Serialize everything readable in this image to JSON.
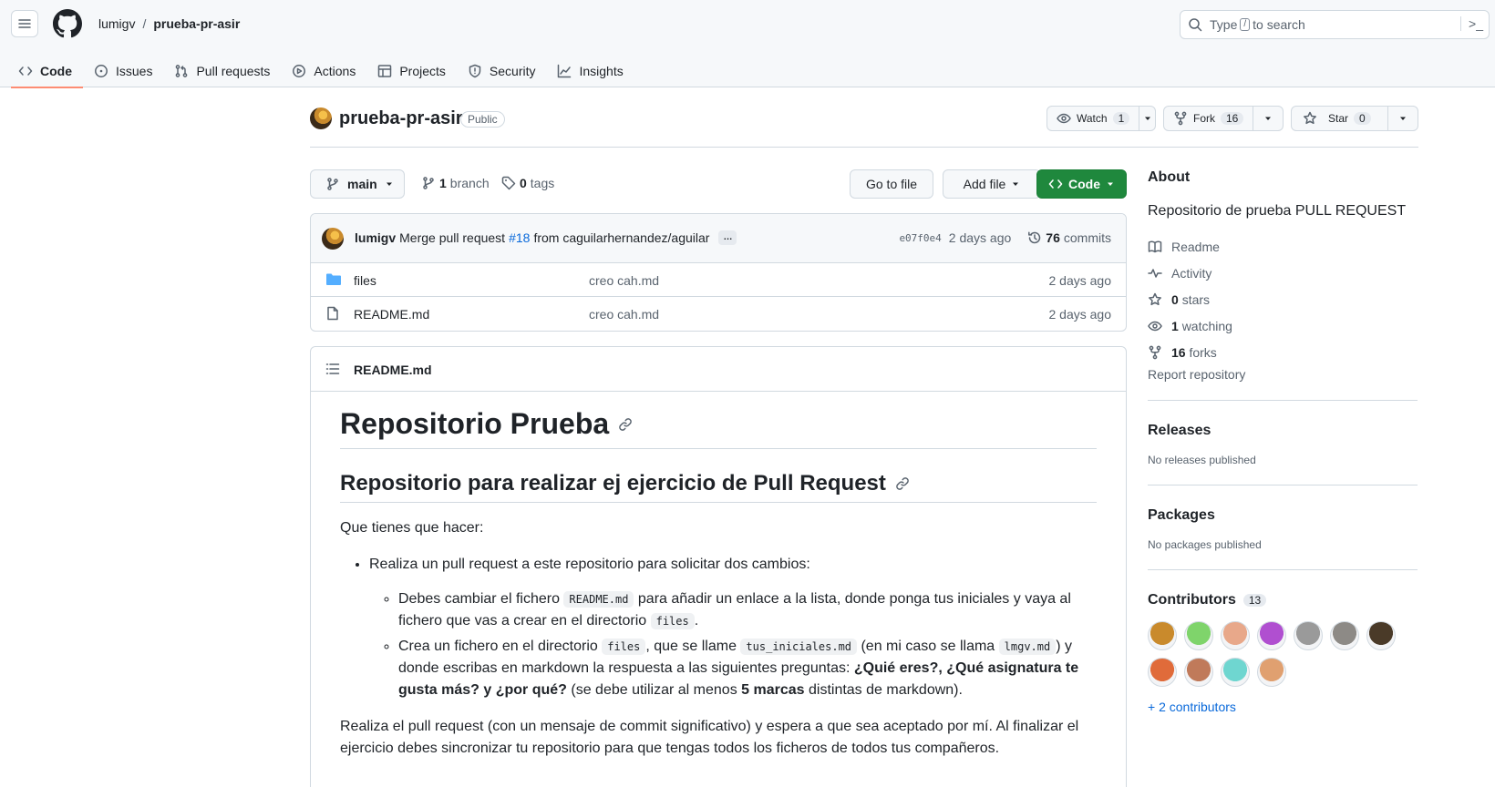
{
  "header": {
    "owner": "lumigv",
    "separator": "/",
    "repo": "prueba-pr-asir",
    "search_pre": "Type",
    "search_key": "/",
    "search_post": "to search",
    "terminal_glyph": ">_"
  },
  "tabs": [
    {
      "label": "Code",
      "icon": "code-icon",
      "active": true
    },
    {
      "label": "Issues",
      "icon": "issue-icon"
    },
    {
      "label": "Pull requests",
      "icon": "pull-request-icon"
    },
    {
      "label": "Actions",
      "icon": "play-icon"
    },
    {
      "label": "Projects",
      "icon": "table-icon"
    },
    {
      "label": "Security",
      "icon": "shield-icon"
    },
    {
      "label": "Insights",
      "icon": "graph-icon"
    }
  ],
  "repo": {
    "name": "prueba-pr-asir",
    "visibility": "Public",
    "watch_label": "Watch",
    "watch_count": "1",
    "fork_label": "Fork",
    "fork_count": "16",
    "star_label": "Star",
    "star_count": "0"
  },
  "toolbar": {
    "branch": "main",
    "branch_count": "1",
    "branch_word": "branch",
    "tag_count": "0",
    "tag_word": "tags",
    "goto_file": "Go to file",
    "add_file": "Add file",
    "code": "Code"
  },
  "commit": {
    "author": "lumigv",
    "message_pre": "Merge pull request",
    "pr": "#18",
    "message_post": "from caguilarhernandez/aguilar",
    "ellipsis": "…",
    "sha": "e07f0e4",
    "date": "2 days ago",
    "commit_count": "76",
    "commit_word": "commits"
  },
  "files": [
    {
      "name": "files",
      "type": "dir",
      "message": "creo cah.md",
      "date": "2 days ago"
    },
    {
      "name": "README.md",
      "type": "file",
      "message": "creo cah.md",
      "date": "2 days ago"
    }
  ],
  "readme": {
    "filename": "README.md",
    "h1": "Repositorio Prueba",
    "h2": "Repositorio para realizar ej ejercicio de Pull Request",
    "intro": "Que tienes que hacer:",
    "bullet1": "Realiza un pull request a este repositorio para solicitar dos cambios:",
    "sub1": {
      "t1": "Debes cambiar el fichero",
      "c1": "README.md",
      "t2": "para añadir un enlace a la lista, donde ponga tus iniciales y vaya al fichero que vas a crear en el directorio",
      "c2": "files",
      "t3": "."
    },
    "sub2": {
      "t1": "Crea un fichero en el directorio",
      "c1": "files",
      "t2": ", que se llame",
      "c2": "tus_iniciales.md",
      "t3": "(en mi caso se llama",
      "c3": "lmgv.md",
      "t4": ") y donde escribas en markdown la respuesta a las siguientes preguntas:",
      "b1": "¿Quié eres?, ¿Qué asignatura te gusta más? y ¿por qué?",
      "t5": "(se debe utilizar al menos",
      "b2": "5 marcas",
      "t6": "distintas de markdown)."
    },
    "closing": "Realiza el pull request (con un mensaje de commit significativo) y espera a que sea aceptado por mí. Al finalizar el ejercicio debes sincronizar tu repositorio para que tengas todos los ficheros de todos tus compañeros."
  },
  "about": {
    "title": "About",
    "description": "Repositorio de prueba PULL REQUEST",
    "readme": "Readme",
    "activity": "Activity",
    "stars_count": "0",
    "stars_word": "stars",
    "watching_count": "1",
    "watching_word": "watching",
    "forks_count": "16",
    "forks_word": "forks",
    "report": "Report repository"
  },
  "releases": {
    "title": "Releases",
    "empty": "No releases published"
  },
  "packages": {
    "title": "Packages",
    "empty": "No packages published"
  },
  "contributors": {
    "title": "Contributors",
    "count": "13",
    "more": "+ 2 contributors",
    "avatars": [
      "#c98a2c",
      "#7fd46b",
      "#e8a88a",
      "#b04fd0",
      "#9a9a9a",
      "#8d8a86",
      "#4a3a28",
      "#e06b3a",
      "#c07a5a",
      "#6fd6d0",
      "#e0a070"
    ]
  },
  "colors": {
    "accent": "#0969da",
    "primary_button": "#1f883d",
    "tab_underline": "#fd8c73",
    "folder": "#54aeff"
  }
}
